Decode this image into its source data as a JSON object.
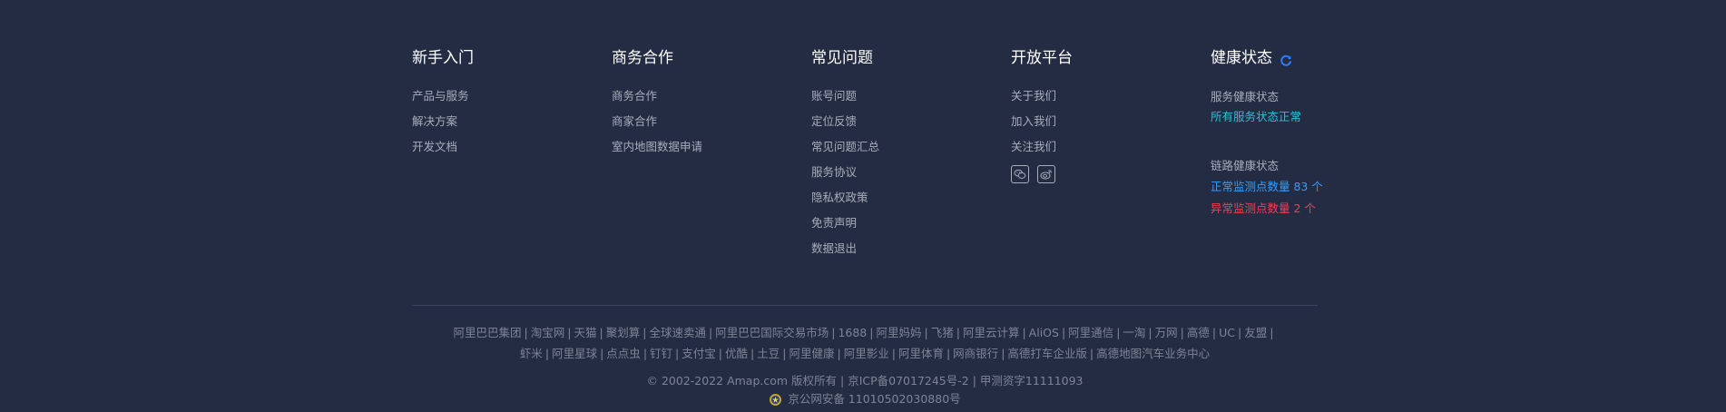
{
  "columns": [
    {
      "title": "新手入门",
      "links": [
        "产品与服务",
        "解决方案",
        "开发文档"
      ]
    },
    {
      "title": "商务合作",
      "links": [
        "商务合作",
        "商家合作",
        "室内地图数据申请"
      ]
    },
    {
      "title": "常见问题",
      "links": [
        "账号问题",
        "定位反馈",
        "常见问题汇总",
        "服务协议",
        "隐私权政策",
        "免责声明",
        "数据退出"
      ]
    },
    {
      "title": "开放平台",
      "links": [
        "关于我们",
        "加入我们",
        "关注我们"
      ]
    }
  ],
  "health": {
    "title": "健康状态",
    "service_label": "服务健康状态",
    "service_status": "所有服务状态正常",
    "link_label": "链路健康状态",
    "normal_points": "正常监测点数量 83 个",
    "abnormal_points": "异常监测点数量 2 个"
  },
  "friends_line1": [
    "阿里巴巴集团",
    "淘宝网",
    "天猫",
    "聚划算",
    "全球速卖通",
    "阿里巴巴国际交易市场",
    "1688",
    "阿里妈妈",
    "飞猪",
    "阿里云计算",
    "AliOS",
    "阿里通信",
    "一淘",
    "万网",
    "高德",
    "UC",
    "友盟"
  ],
  "friends_line2": [
    "虾米",
    "阿里星球",
    "点点虫",
    "钉钉",
    "支付宝",
    "优酷",
    "土豆",
    "阿里健康",
    "阿里影业",
    "阿里体育",
    "网商银行",
    "高德打车企业版",
    "高德地图汽车业务中心"
  ],
  "copyright": "© 2002-2022 Amap.com 版权所有 | 京ICP备07017245号-2 | 甲测资字11111093",
  "police": "京公网安备 11010502030880号",
  "icons": {
    "refresh": "refresh-icon",
    "wechat": "wechat-icon",
    "weibo": "weibo-icon",
    "police": "police-badge-icon"
  },
  "colors": {
    "background": "#242c44",
    "ok": "#1fc5d6",
    "normal": "#2f9fff",
    "abnormal": "#ff3b4c",
    "refresh": "#2f7bff"
  }
}
